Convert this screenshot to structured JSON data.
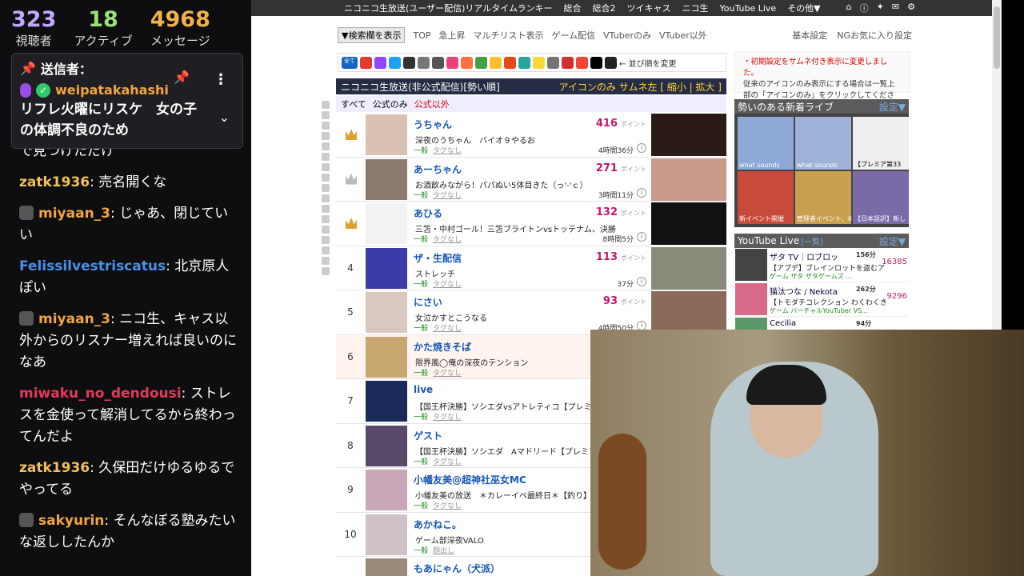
{
  "stats": [
    {
      "value": "323",
      "label": "視聴者",
      "color": "#c0a8ff"
    },
    {
      "value": "18",
      "label": "アクティブ",
      "color": "#9be07a"
    },
    {
      "value": "4968",
      "label": "メッセージ",
      "color": "#f0b24a"
    }
  ],
  "pinned": {
    "header": "送信者：",
    "sender": "weipatakahashi",
    "message": "リフレ火曜にリスケ　女の子の体調不良のため"
  },
  "chat": [
    {
      "user": "miyaan_3",
      "user_color": "#f0a540",
      "text": "で見つけただけ"
    },
    {
      "user": "zatk1936",
      "user_color": "#f0c060",
      "text": "売名開くな"
    },
    {
      "user": "miyaan_3",
      "user_color": "#f0a540",
      "text": "じゃあ、閉じていい"
    },
    {
      "user": "Felissilvestriscatus",
      "user_color": "#4a90e8",
      "text": "北京原人ぽい"
    },
    {
      "user": "miyaan_3",
      "user_color": "#f0a540",
      "text": "ニコ生、キャス以外からのリスナー増えれば良いのになあ"
    },
    {
      "user": "miwaku_no_dendousi",
      "user_color": "#e8385a",
      "text": "ストレスを金使って解消してるから終わってんだよ"
    },
    {
      "user": "zatk1936",
      "user_color": "#f0c060",
      "text": "久保田だけゆるゆるでやってる"
    },
    {
      "user": "sakyurin",
      "user_color": "#f0a540",
      "text": "そんなぼる塾みたいな返ししたんか"
    }
  ],
  "topbar": {
    "title": "ニコニコ生放送(ユーザー配信)リアルタイムランキー",
    "links": [
      "総合",
      "総合2",
      "ツイキャス",
      "ニコ生",
      "YouTube Live",
      "その他▼"
    ]
  },
  "nav": {
    "search_label": "▼検索欄を表示",
    "links": [
      "TOP",
      "急上昇",
      "マルチリスト表示",
      "ゲーム配信",
      "VTuberのみ",
      "VTuber以外"
    ],
    "right": [
      "基本設定",
      "NGお気に入り設定"
    ]
  },
  "services_label": "← 並び順を変更",
  "services_all": "全て",
  "ranking_header": {
    "title": "ニコニコ生放送(非公式配信)[勢い順]",
    "options": "アイコンのみ サムネ左 [ 縮小 | 拡大 ]"
  },
  "filters": [
    "すべて",
    "公式のみ",
    "公式以外"
  ],
  "ranking": [
    {
      "rank": "",
      "crown": "gold",
      "name": "うちゃん",
      "desc": "深夜のうちゃん　バイオ９やるお",
      "tag": "一般",
      "tag2": "タグなし",
      "points": "416",
      "dur": "4時間36分"
    },
    {
      "rank": "",
      "crown": "silver",
      "name": "あーちゃん",
      "desc": "お酒飲みながら！パパぬい5体目きた（っ'-'ｃ）",
      "tag": "一般",
      "tag2": "タグなし",
      "points": "271",
      "dur": "3時間11分"
    },
    {
      "rank": "",
      "crown": "gold",
      "name": "あひる",
      "desc": "三笘・中村ゴール！三笘ブライトンvsトッテナム、決勝",
      "tag": "一般",
      "tag2": "タグなし",
      "points": "132",
      "dur": "8時間5分"
    },
    {
      "rank": "4",
      "crown": "",
      "name": "ザ・生配信",
      "desc": "ストレッチ",
      "tag": "一般",
      "tag2": "タグなし",
      "points": "113",
      "dur": "37分"
    },
    {
      "rank": "5",
      "crown": "",
      "name": "にさい",
      "desc": "女泣かすとこうなる",
      "tag": "一般",
      "tag2": "タグなし",
      "points": "93",
      "dur": "4時間50分"
    },
    {
      "rank": "6",
      "crown": "",
      "name": "かた焼きそば",
      "desc": "限界風◯俺の深夜のテンション",
      "tag": "一般",
      "tag2": "タグなし",
      "points": "",
      "dur": ""
    },
    {
      "rank": "7",
      "crown": "",
      "name": "live",
      "desc": "【国王杯決勝】ソシエダvsアトレティコ【プレミア】チ",
      "tag": "一般",
      "tag2": "タグなし",
      "points": "",
      "dur": ""
    },
    {
      "rank": "8",
      "crown": "",
      "name": "ゲスト",
      "desc": "【国王杯決勝】ソシエダ　Aマドリード【プレミアリー",
      "tag": "一般",
      "tag2": "タグなし",
      "points": "",
      "dur": ""
    },
    {
      "rank": "9",
      "crown": "",
      "name": "小幡友美@超神社巫女MC",
      "desc": "小幡友美の放送　＊カレーイベ最終日＊【釣り】朝マズ",
      "tag": "一般",
      "tag2": "タグなし",
      "points": "",
      "dur": ""
    },
    {
      "rank": "10",
      "crown": "",
      "name": "あかねこ。",
      "desc": "ゲーム部深夜VALO",
      "tag": "一般",
      "tag2": "顔出し",
      "points": "",
      "dur": ""
    },
    {
      "rank": "",
      "crown": "",
      "name": "もあにゃん（犬派）",
      "desc": "",
      "tag": "",
      "tag2": "",
      "points": "",
      "dur": ""
    }
  ],
  "points_unit": "ポイント",
  "notice": {
    "line1": "・初期設定をサムネ付き表示に変更しました。",
    "line2": "従来のアイコンのみ表示にする場合は一覧上部の「アイコンのみ」をクリックしてください。"
  },
  "newlive": {
    "title": "勢いのある新着ライブ",
    "settings": "設定▼",
    "items": [
      "what sounds",
      "what sounds",
      "【プレミア第33",
      "新イベント開催",
      "管理者イベント、6",
      "【日本語訳】新し"
    ]
  },
  "youtube": {
    "title": "YouTube Live",
    "list_link": "[一覧]",
    "settings": "設定▼",
    "items": [
      {
        "name": "ザタ TV｜ロブロッ",
        "min": "156分",
        "desc": "【アプデ】ブレインロットを盗むア",
        "tag": "ゲーム ザタ ザタゲームズ ...",
        "viewers": "16385"
      },
      {
        "name": "猫汰つな / Nekota",
        "min": "262分",
        "desc": "【トモダチコレクション わくわくき",
        "tag": "ゲーム バーチャルYouTuber VS...",
        "viewers": "9296"
      },
      {
        "name": "Cecilia",
        "min": "94分",
        "desc": "",
        "tag": "",
        "viewers": ""
      }
    ]
  }
}
